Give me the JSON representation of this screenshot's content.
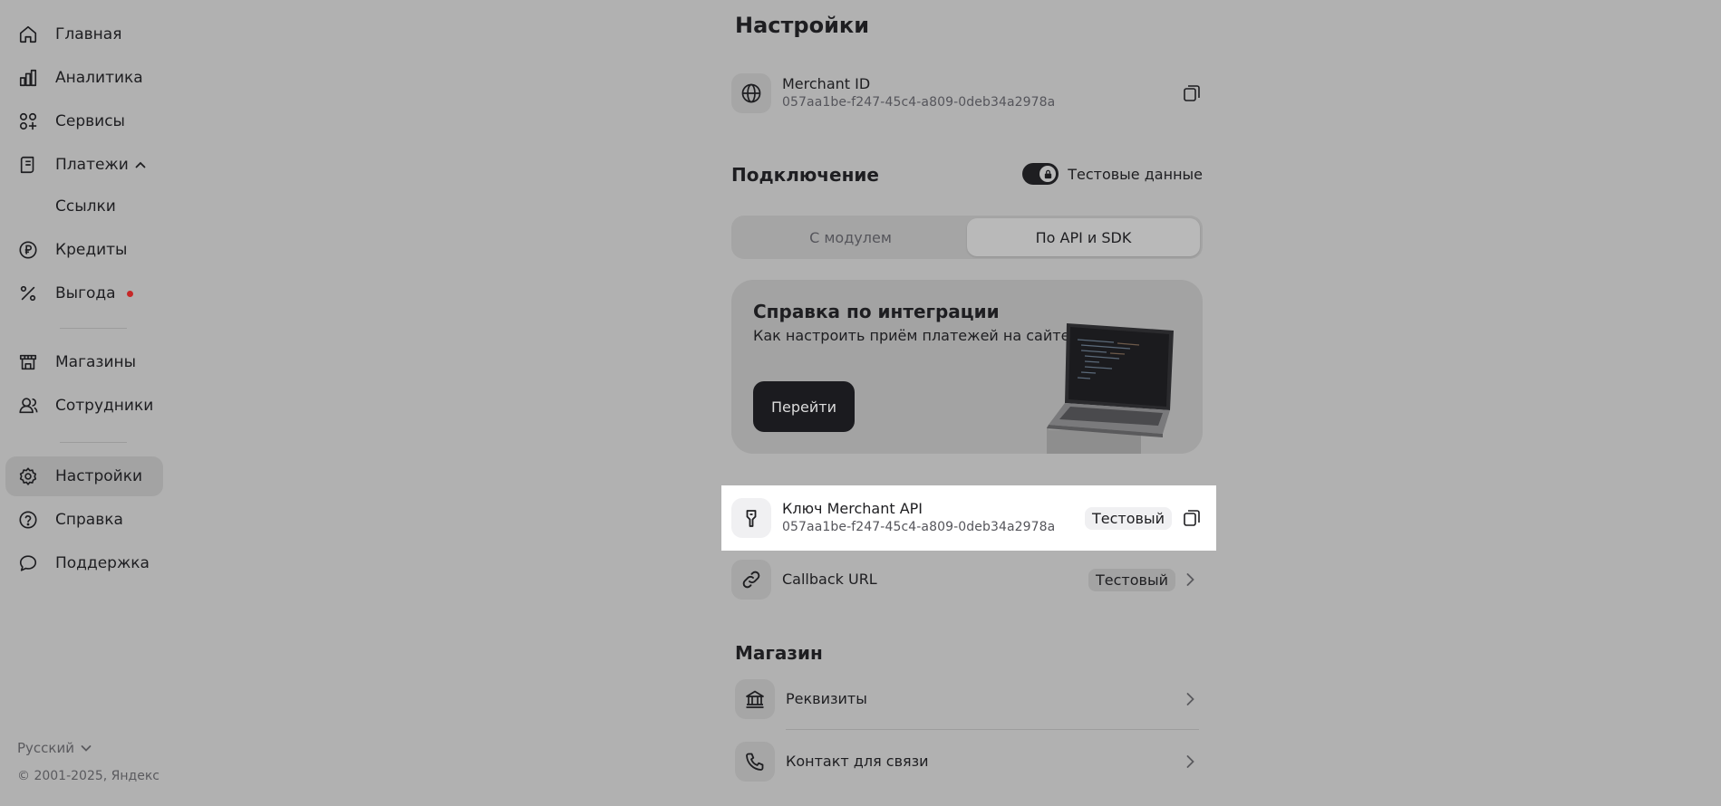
{
  "sidebar": {
    "items": [
      {
        "label": "Главная",
        "icon": "home-icon"
      },
      {
        "label": "Аналитика",
        "icon": "bar-chart-icon"
      },
      {
        "label": "Сервисы",
        "icon": "services-icon"
      },
      {
        "label": "Платежи",
        "icon": "receipt-icon"
      },
      {
        "label": "Ссылки"
      },
      {
        "label": "Кредиты",
        "icon": "ruble-icon"
      },
      {
        "label": "Выгода",
        "icon": "percent-icon"
      },
      {
        "label": "Магазины",
        "icon": "store-icon"
      },
      {
        "label": "Сотрудники",
        "icon": "people-icon"
      },
      {
        "label": "Настройки",
        "icon": "gear-icon"
      },
      {
        "label": "Справка",
        "icon": "help-icon"
      },
      {
        "label": "Поддержка",
        "icon": "chat-icon"
      }
    ],
    "active": "Настройки",
    "language": "Русский",
    "copyright": "© 2001-2025, Яндекс"
  },
  "main": {
    "title": "Настройки",
    "merchant": {
      "label": "Merchant ID",
      "value": "057aa1be-f247-45c4-a809-0deb34a2978a"
    },
    "connection": {
      "heading": "Подключение",
      "toggle_label": "Тестовые данные",
      "toggle_on": true,
      "tabs": [
        "С модулем",
        "По API и SDK"
      ],
      "selected_tab": "По API и SDK"
    },
    "promo": {
      "title": "Справка по интеграции",
      "subtitle": "Как настроить приём платежей на сайте",
      "button": "Перейти"
    },
    "api_key": {
      "label": "Ключ Merchant API",
      "value": "057aa1be-f247-45c4-a809-0deb34a2978a",
      "badge": "Тестовый"
    },
    "callback": {
      "label": "Callback URL",
      "badge": "Тестовый"
    },
    "store": {
      "heading": "Магазин",
      "items": [
        {
          "label": "Реквизиты"
        },
        {
          "label": "Контакт для связи"
        }
      ]
    }
  },
  "colors": {
    "overlay_bg": "#b1b1b1",
    "highlight_bg": "#ffffff",
    "accent_dark": "#1b1b1f",
    "notification_dot": "#c62828"
  }
}
